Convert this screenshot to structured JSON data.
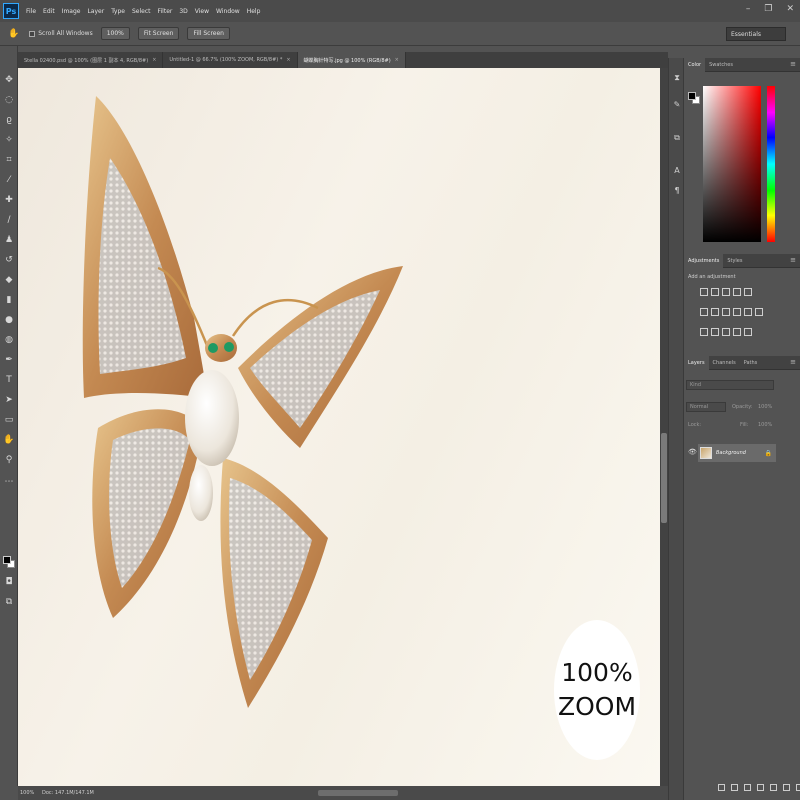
{
  "menubar": {
    "logo": "Ps",
    "items": [
      "File",
      "Edit",
      "Image",
      "Layer",
      "Type",
      "Select",
      "Filter",
      "3D",
      "View",
      "Window",
      "Help"
    ],
    "min": "–",
    "restore": "❐",
    "close": "✕"
  },
  "options": {
    "scroll_all_label": "Scroll All Windows",
    "zoom_btn": "100%",
    "fit_btn": "Fit Screen",
    "fill_btn": "Fill Screen",
    "workspace": "Essentials"
  },
  "tabs": [
    {
      "label": "Stella 02400.psd @ 100% (图层 1 副本 4, RGB/8#)",
      "close": "×"
    },
    {
      "label": "Untitled-1 @ 66.7% (100% ZOOM, RGB/8#) *",
      "close": "×"
    },
    {
      "label": "蝴蝶胸针特写.jpg @ 100% (RGB/8#)",
      "close": "×"
    }
  ],
  "canvas": {
    "zoom_line1": "100%",
    "zoom_line2": "ZOOM"
  },
  "status": {
    "zoom": "100%",
    "doc": "Doc: 147.1M/147.1M"
  },
  "panels": {
    "color_tab": "Color",
    "swatches_tab": "Swatches",
    "adjustments_tab": "Adjustments",
    "styles_tab": "Styles",
    "add_adjustment": "Add an adjustment",
    "layers_tab": "Layers",
    "channels_tab": "Channels",
    "paths_tab": "Paths",
    "kind_placeholder": "Kind",
    "blend_mode": "Normal",
    "opacity_label": "Opacity:",
    "opacity_value": "100%",
    "lock_label": "Lock:",
    "fill_label": "Fill:",
    "fill_value": "100%",
    "layer_name": "Background",
    "menu_glyph": "≡"
  },
  "colors": {
    "fg": "#000000",
    "bg": "#ffffff",
    "accent": "#31a8ff"
  },
  "icons": {
    "hand": "hand-tool-icon",
    "eye": "eye-icon",
    "lock": "lock-icon"
  }
}
